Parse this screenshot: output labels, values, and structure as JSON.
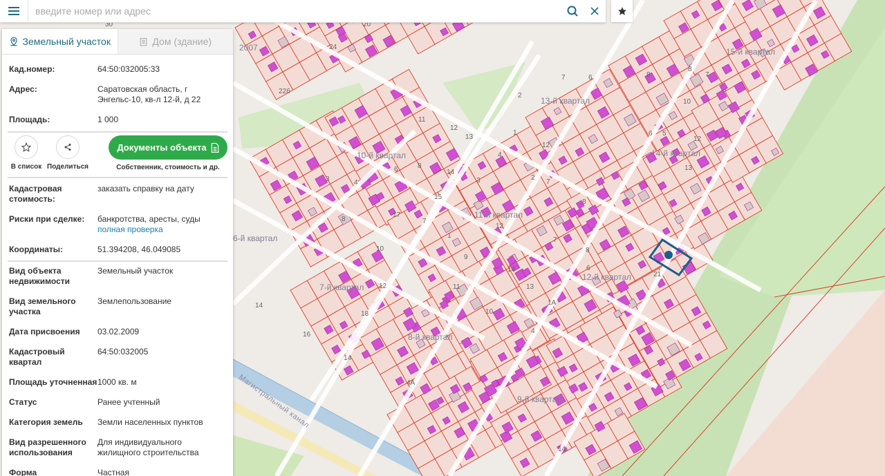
{
  "search": {
    "placeholder": "введите номер или адрес"
  },
  "icons": {
    "menu": "menu-icon",
    "search": "search-icon",
    "clear": "close-icon",
    "favorite": "star-icon"
  },
  "colors": {
    "accent": "#1d6b84",
    "link": "#1b7ea6",
    "green_button": "#2faa4a",
    "parcel_fill": "#f4dcd6",
    "parcel_stroke": "#d8442f",
    "building": "#d14fd0",
    "road": "#ffffff",
    "green_area": "#cfe6b9",
    "canal": "#a9c6dc",
    "selected": "#1c5e8c"
  },
  "tabs": [
    {
      "label": "Земельный участок",
      "icon": "map-pin-icon",
      "active": true
    },
    {
      "label": "Дом (здание)",
      "icon": "building-icon",
      "active": false
    }
  ],
  "info": {
    "cad_number": {
      "label": "Кад.номер:",
      "value": "64:50:032005:33"
    },
    "address": {
      "label": "Адрес:",
      "value_line1": "Саратовская область, г",
      "value_line2": "Энгельс-10, кв-л 12-й, д 22"
    },
    "area": {
      "label": "Площадь:",
      "value": "1 000"
    }
  },
  "actions": {
    "favorite_label": "В список",
    "share_label": "Поделиться",
    "documents_label": "Документы объекта",
    "documents_sub": "Собственник, стоимость и др."
  },
  "details": {
    "cad_cost": {
      "label_line1": "Кадастровая",
      "label_line2": "стоимость:",
      "value": "заказать справку на дату"
    },
    "risks": {
      "label": "Риски при сделке:",
      "value": "банкротства, аресты, суды",
      "link": "полная проверка"
    },
    "coords": {
      "label": "Координаты:",
      "value": "51.394208, 46.049085"
    }
  },
  "properties": [
    {
      "label_line1": "Вид объекта",
      "label_line2": "недвижимости",
      "value_line1": "Земельный участок",
      "value_line2": ""
    },
    {
      "label_line1": "Вид земельного",
      "label_line2": "участка",
      "value_line1": "Землепользование",
      "value_line2": ""
    },
    {
      "label_line1": "Дата присвоения",
      "label_line2": "",
      "value_line1": "03.02.2009",
      "value_line2": ""
    },
    {
      "label_line1": "Кадастровый",
      "label_line2": "квартал",
      "value_line1": "64:50:032005",
      "value_line2": ""
    },
    {
      "label_line1": "Площадь уточненная",
      "label_line2": "",
      "value_line1": "1000 кв. м",
      "value_line2": ""
    },
    {
      "label_line1": "Статус",
      "label_line2": "",
      "value_line1": "Ранее учтенный",
      "value_line2": ""
    },
    {
      "label_line1": "Категория земель",
      "label_line2": "",
      "value_line1": "Земли населенных пунктов",
      "value_line2": ""
    },
    {
      "label_line1": "Вид разрешенного",
      "label_line2": "использования",
      "value_line1": "Для индивидуального",
      "value_line2": "жилищного строительства"
    },
    {
      "label_line1": "Форма",
      "label_line2": "",
      "value_line1": "Частная",
      "value_line2": ""
    }
  ],
  "map": {
    "quarter_labels": [
      "15-й квартал",
      "13-й квартал",
      "14-й квартал",
      "10-й квартал",
      "11-й квартал",
      "6-й квартал",
      "7-й квартал",
      "12-й квартал",
      "8-й квартал",
      "9-й квартал",
      "2007"
    ],
    "canal_label": "Магистральный канал",
    "lot_numbers": [
      "30",
      "20",
      "24",
      "22б",
      "7",
      "6",
      "8",
      "8",
      "7",
      "11",
      "12",
      "13",
      "2",
      "1",
      "12",
      "6",
      "5",
      "10",
      "12",
      "13",
      "3",
      "4",
      "6",
      "8",
      "14",
      "3",
      "7",
      "4",
      "2",
      "15",
      "17",
      "8",
      "7",
      "1",
      "8",
      "12",
      "7",
      "8",
      "6",
      "10",
      "21",
      "9",
      "14",
      "11",
      "13",
      "1A",
      "14",
      "16",
      "14",
      "4A",
      "18",
      "12",
      "10",
      "4",
      "14"
    ]
  }
}
